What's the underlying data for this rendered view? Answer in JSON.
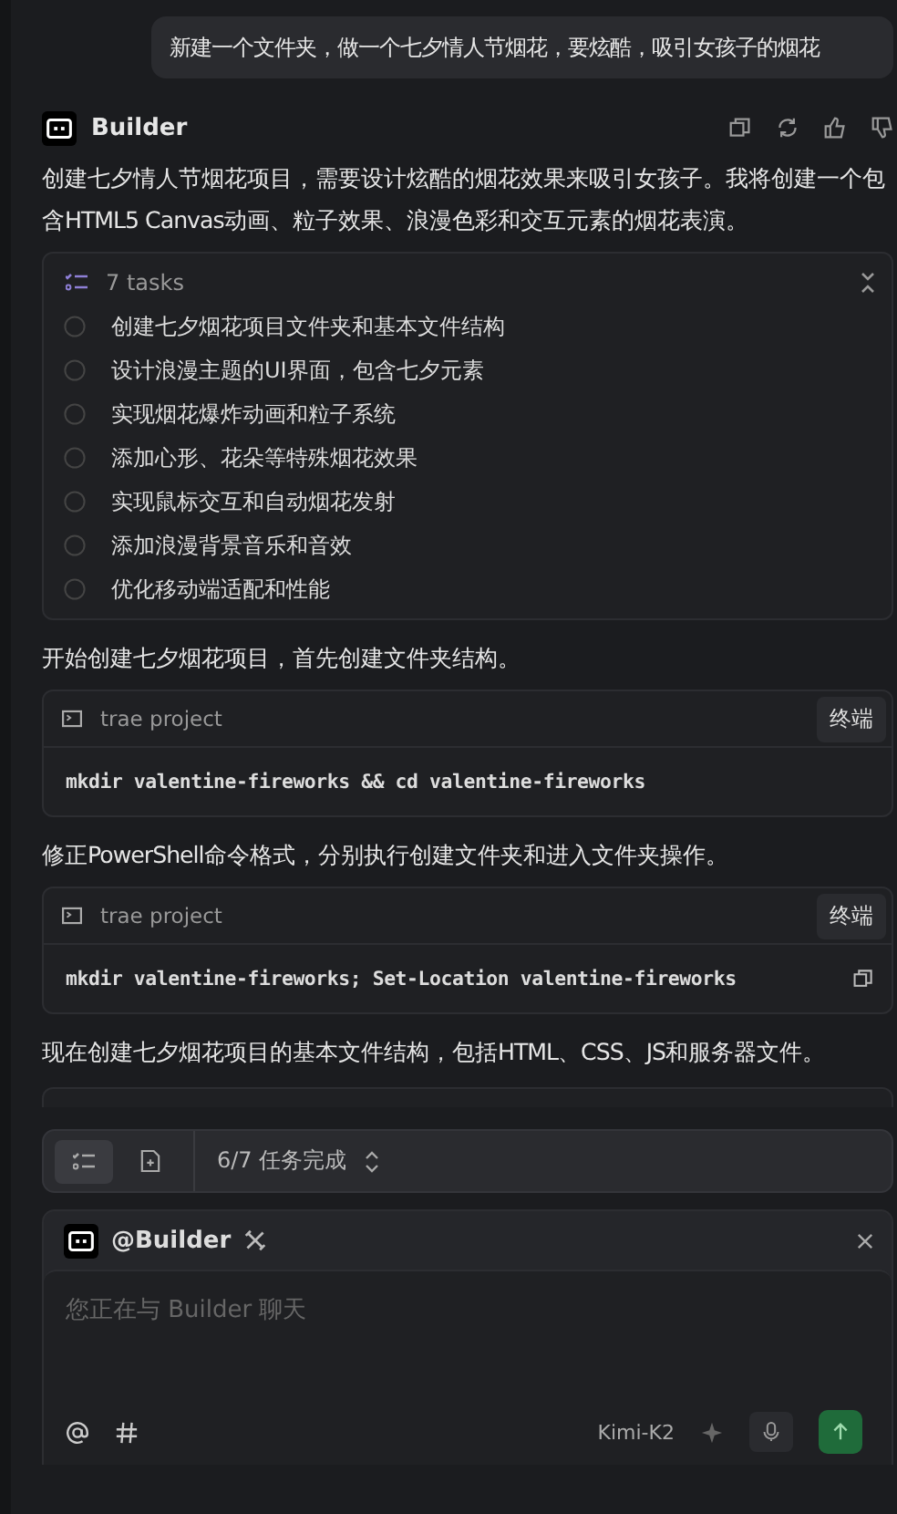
{
  "user_message": "新建一个文件夹，做一个七夕情人节烟花，要炫酷，吸引女孩子的烟花",
  "assistant": {
    "name": "Builder",
    "intro": "创建七夕情人节烟花项目，需要设计炫酷的烟花效果来吸引女孩子。我将创建一个包含HTML5 Canvas动画、粒子效果、浪漫色彩和交互元素的烟花表演。",
    "tasks": {
      "title": "7 tasks",
      "expanded": true,
      "items": [
        {
          "label": "创建七夕烟花项目文件夹和基本文件结构",
          "checked": false
        },
        {
          "label": "设计浪漫主题的UI界面，包含七夕元素",
          "checked": false
        },
        {
          "label": "实现烟花爆炸动画和粒子系统",
          "checked": false
        },
        {
          "label": "添加心形、花朵等特殊烟花效果",
          "checked": false
        },
        {
          "label": "实现鼠标交互和自动烟花发射",
          "checked": false
        },
        {
          "label": "添加浪漫背景音乐和音效",
          "checked": false
        },
        {
          "label": "优化移动端适配和性能",
          "checked": false
        }
      ]
    },
    "steps": [
      {
        "kind": "text",
        "text": "开始创建七夕烟花项目，首先创建文件夹结构。"
      },
      {
        "kind": "command",
        "project": "trae project",
        "button": "终端",
        "command": "mkdir valentine-fireworks && cd valentine-fireworks",
        "copy": false
      },
      {
        "kind": "text",
        "text": "修正PowerShell命令格式，分别执行创建文件夹和进入文件夹操作。"
      },
      {
        "kind": "command",
        "project": "trae project",
        "button": "终端",
        "command": "mkdir valentine-fireworks; Set-Location valentine-fireworks",
        "copy": true
      },
      {
        "kind": "text",
        "text": "现在创建七夕烟花项目的基本文件结构，包括HTML、CSS、JS和服务器文件。"
      },
      {
        "kind": "partial"
      }
    ]
  },
  "progress": {
    "label": "6/7 任务完成",
    "tabs": [
      {
        "kind": "tasks",
        "selected": true
      },
      {
        "kind": "files",
        "selected": false
      }
    ]
  },
  "composer": {
    "agent": "@Builder",
    "placeholder": "您正在与 Builder 聊天",
    "model": "Kimi-K2"
  }
}
